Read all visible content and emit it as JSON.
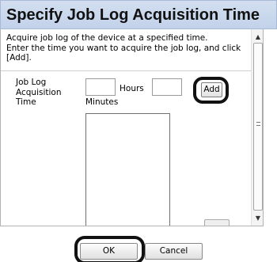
{
  "dialog": {
    "title": "Specify Job Log Acquisition Time",
    "description_lines": [
      "Acquire job log of the device at a specified time.",
      "Enter the time you want to acquire the job log, and click",
      "[Add]."
    ]
  },
  "form": {
    "time_label_lines": [
      "Job Log",
      "Acquisition",
      "Time"
    ],
    "hours_value": "",
    "hours_label": "Hours",
    "minutes_value": "",
    "minutes_label": "Minutes",
    "add_label": "Add",
    "time_list_items": []
  },
  "scrollbar": {
    "up_icon": "▲",
    "down_icon": "▼"
  },
  "footer": {
    "ok_label": "OK",
    "cancel_label": "Cancel"
  }
}
